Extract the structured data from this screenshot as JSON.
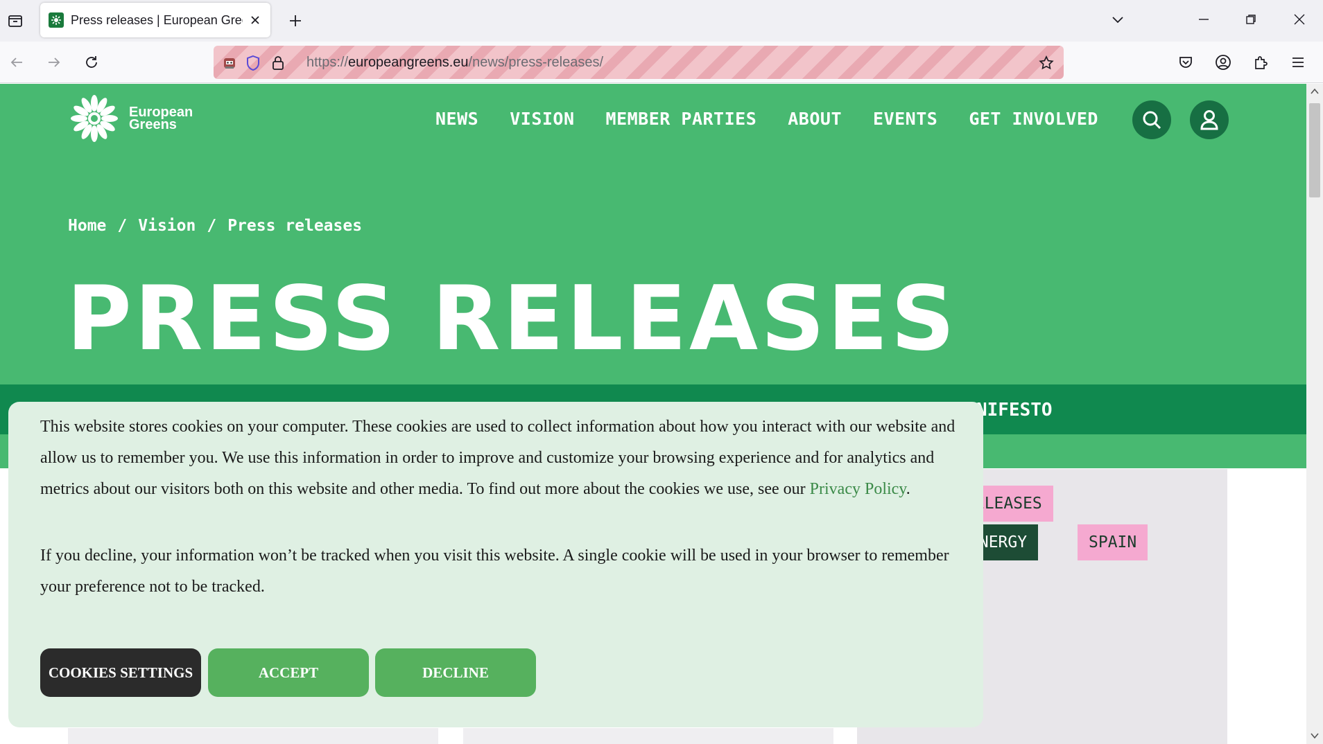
{
  "browser": {
    "tab": {
      "title": "Press releases | European Greens"
    },
    "url": {
      "scheme": "https://",
      "host": "europeangreens.eu",
      "path": "/news/press-releases/"
    }
  },
  "site": {
    "logo": {
      "line1": "European",
      "line2": "Greens"
    },
    "nav": [
      "NEWS",
      "VISION",
      "MEMBER PARTIES",
      "ABOUT",
      "EVENTS",
      "GET INVOLVED"
    ],
    "breadcrumb": {
      "home": "Home",
      "sep": "/",
      "vision": "Vision",
      "current": "Press releases"
    },
    "title": "PRESS RELEASES",
    "strip_text": "NIFESTO",
    "tags": [
      "RELEASES",
      "ENERGY",
      "SPAIN"
    ]
  },
  "cookie_banner": {
    "para1": "This website stores cookies on your computer. These cookies are used to collect information about how you interact with our website and allow us to remember you. We use this information in order to improve and customize your browsing experience and for analytics and metrics about our visitors both on this website and other media. To find out more about the cookies we use, see our ",
    "privacy_link": "Privacy Policy",
    "para1_end": ".",
    "para2": "If you decline, your information won’t be tracked when you visit this website. A single cookie will be used in your browser to remember your preference not to be tracked.",
    "buttons": {
      "settings": "COOKIES SETTINGS",
      "accept": "ACCEPT",
      "decline": "DECLINE"
    }
  },
  "colors": {
    "hero_green": "#48b971",
    "strip_green": "#10894f",
    "banner_bg": "#dff0e3",
    "button_green": "#56b15e"
  }
}
